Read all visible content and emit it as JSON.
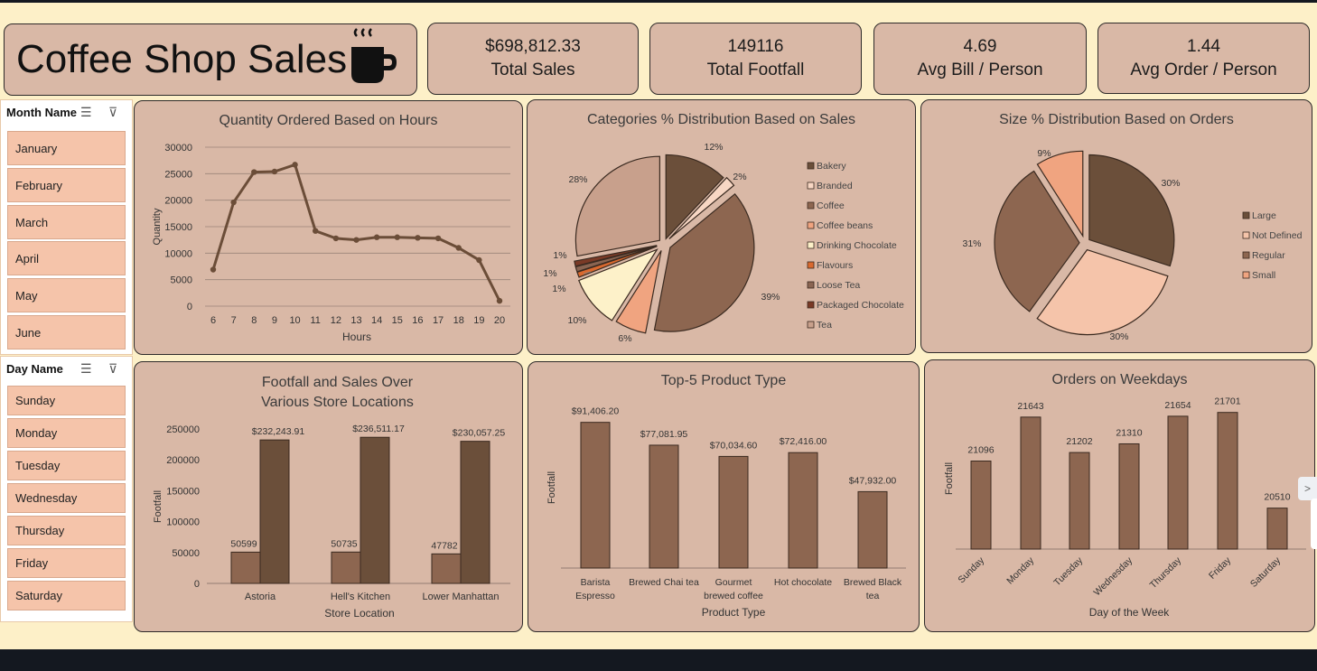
{
  "header": {
    "title": "Coffee Shop Sales",
    "icon": "coffee-cup-icon"
  },
  "kpis": [
    {
      "value": "$698,812.33",
      "label": "Total Sales"
    },
    {
      "value": "149116",
      "label": "Total Footfall"
    },
    {
      "value": "4.69",
      "label": "Avg Bill / Person"
    },
    {
      "value": "1.44",
      "label": "Avg Order / Person"
    }
  ],
  "slicers": {
    "month": {
      "title": "Month Name",
      "items": [
        "January",
        "February",
        "March",
        "April",
        "May",
        "June"
      ]
    },
    "day": {
      "title": "Day Name",
      "items": [
        "Sunday",
        "Monday",
        "Tuesday",
        "Wednesday",
        "Thursday",
        "Friday",
        "Saturday"
      ]
    }
  },
  "colors": {
    "panel": "#d9b8a6",
    "background": "#fdf0c8",
    "dark_brown": "#6b4d38",
    "bar": "#8d6650",
    "slicer_button": "#f5c4aa"
  },
  "chart_data": [
    {
      "id": "hours",
      "type": "line",
      "title": "Quantity Ordered Based on Hours",
      "xlabel": "Hours",
      "ylabel": "Quantity",
      "x": [
        6,
        7,
        8,
        9,
        10,
        11,
        12,
        13,
        14,
        15,
        16,
        17,
        18,
        19,
        20
      ],
      "values": [
        6900,
        19600,
        25300,
        25400,
        26700,
        14200,
        12800,
        12500,
        13000,
        13000,
        12900,
        12800,
        11000,
        8700,
        1000
      ],
      "ylim": [
        0,
        30000
      ],
      "yticks": [
        "0",
        "5000",
        "10000",
        "15000",
        "20000",
        "25000",
        "30000"
      ],
      "grid": true,
      "color": "#6b4d38"
    },
    {
      "id": "categories",
      "type": "pie",
      "title": "Categories % Distribution Based on Sales",
      "legend_position": "right",
      "slices": [
        {
          "name": "Bakery",
          "percent": 12,
          "label": "12%",
          "color": "#6b4f3a"
        },
        {
          "name": "Branded",
          "percent": 2,
          "label": "2%",
          "color": "#f8d7c4"
        },
        {
          "name": "Coffee",
          "percent": 39,
          "label": "39%",
          "color": "#8d6650"
        },
        {
          "name": "Coffee beans",
          "percent": 6,
          "label": "6%",
          "color": "#f0a480"
        },
        {
          "name": "Drinking Chocolate",
          "percent": 10,
          "label": "10%",
          "color": "#fdf1c9"
        },
        {
          "name": "Flavours",
          "percent": 1,
          "label": "1%",
          "color": "#d9692f"
        },
        {
          "name": "Loose Tea",
          "percent": 1,
          "label": "1%",
          "color": "#8a6552"
        },
        {
          "name": "Packaged Chocolate",
          "percent": 1,
          "label": "1%",
          "color": "#7a3a26"
        },
        {
          "name": "Tea",
          "percent": 28,
          "label": "28%",
          "color": "#c8a08c"
        }
      ]
    },
    {
      "id": "sizes",
      "type": "pie",
      "title": "Size % Distribution Based on Orders",
      "legend_position": "right",
      "slices": [
        {
          "name": "Large",
          "percent": 30,
          "label": "30%",
          "color": "#6b4f3a"
        },
        {
          "name": "Not Defined",
          "percent": 30,
          "label": "30%",
          "color": "#f5c4aa"
        },
        {
          "name": "Regular",
          "percent": 31,
          "label": "31%",
          "color": "#8d6650"
        },
        {
          "name": "Small",
          "percent": 9,
          "label": "9%",
          "color": "#f0a480"
        }
      ]
    },
    {
      "id": "locations",
      "type": "bar",
      "title": "Footfall and Sales Over Various Store Locations",
      "xlabel": "Store Location",
      "ylabel": "Footfall",
      "categories": [
        "Astoria",
        "Hell's Kitchen",
        "Lower Manhattan"
      ],
      "series": [
        {
          "values": [
            50599,
            50735,
            47782
          ],
          "labels": [
            "50599",
            "50735",
            "47782"
          ],
          "color": "#8d6650"
        },
        {
          "values": [
            232243.91,
            236511.17,
            230057.25
          ],
          "labels": [
            "$232,243.91",
            "$236,511.17",
            "$230,057.25"
          ],
          "color": "#6b4f3a"
        }
      ],
      "ylim": [
        0,
        250000
      ],
      "yticks": [
        "0",
        "50000",
        "100000",
        "150000",
        "200000",
        "250000"
      ]
    },
    {
      "id": "products",
      "type": "bar",
      "title": "Top-5 Product Type",
      "xlabel": "Product Type",
      "ylabel": "Footfall",
      "categories": [
        "Barista Espresso",
        "Brewed Chai tea",
        "Gourmet brewed coffee",
        "Hot chocolate",
        "Brewed Black tea"
      ],
      "category_lines": [
        [
          "Barista",
          "Espresso"
        ],
        [
          "Brewed Chai tea"
        ],
        [
          "Gourmet",
          "brewed coffee"
        ],
        [
          "Hot chocolate"
        ],
        [
          "Brewed Black",
          "tea"
        ]
      ],
      "values": [
        91406.2,
        77081.95,
        70034.6,
        72416.0,
        47932.0
      ],
      "labels": [
        "$91,406.20",
        "$77,081.95",
        "$70,034.60",
        "$72,416.00",
        "$47,932.00"
      ],
      "ylim": [
        0,
        100000
      ],
      "color": "#8d6650"
    },
    {
      "id": "weekdays",
      "type": "bar",
      "title": "Orders on Weekdays",
      "xlabel": "Day of the Week",
      "ylabel": "Footfall",
      "categories": [
        "Sunday",
        "Monday",
        "Tuesday",
        "Wednesday",
        "Thursday",
        "Friday",
        "Saturday"
      ],
      "values": [
        21096,
        21643,
        21202,
        21310,
        21654,
        21701,
        20510
      ],
      "labels": [
        "21096",
        "21643",
        "21202",
        "21310",
        "21654",
        "21701",
        "20510"
      ],
      "ylim": [
        20000,
        21900
      ],
      "color": "#8d6650"
    }
  ]
}
